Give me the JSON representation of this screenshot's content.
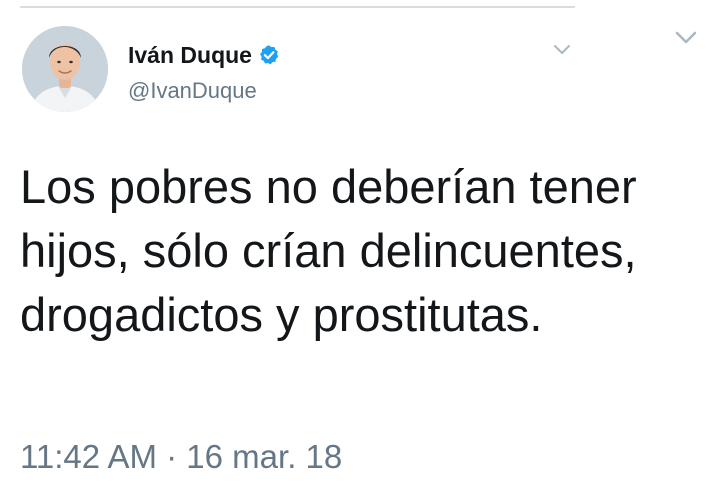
{
  "tweet": {
    "author": {
      "display_name": "Iván Duque",
      "handle": "@IvanDuque",
      "verified": true,
      "avatar_icon": "profile-photo"
    },
    "text": "Los pobres no deberían tener hijos, sólo crían delincuentes, drogadictos y prostitutas.",
    "timestamp": "11:42 AM · 16 mar. 18",
    "menu_icon": "chevron-down-icon"
  },
  "colors": {
    "text_primary": "#14171a",
    "text_secondary": "#657786",
    "verified_blue": "#1da1f2",
    "divider": "#d9dde1"
  }
}
